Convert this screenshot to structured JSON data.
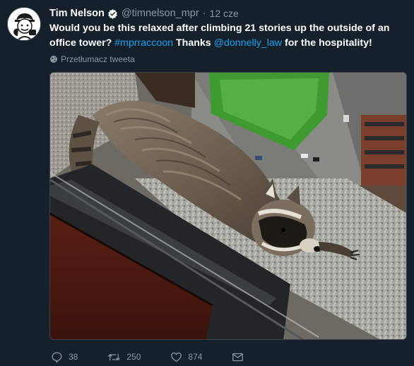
{
  "tweet": {
    "author": {
      "name": "Tim Nelson",
      "handle": "@timnelson_mpr",
      "verified": true
    },
    "time": "12 cze",
    "text_parts": [
      {
        "type": "text",
        "value": "Would you be this relaxed after climbing 21 stories up the outside of an office tower? "
      },
      {
        "type": "link",
        "value": "#mprraccoon"
      },
      {
        "type": "text",
        "value": " Thanks "
      },
      {
        "type": "link",
        "value": "@donnelly_law"
      },
      {
        "type": "text",
        "value": " for the hospitality!"
      }
    ],
    "translate_label": "Przetłumacz tweeta",
    "media": {
      "icon": "raccoon-photo"
    },
    "actions": {
      "reply_count": "38",
      "retweet_count": "250",
      "like_count": "874"
    }
  },
  "colors": {
    "background": "#15202b",
    "link": "#1da1f2",
    "muted": "#8899a6",
    "verified": "#ffffff"
  }
}
